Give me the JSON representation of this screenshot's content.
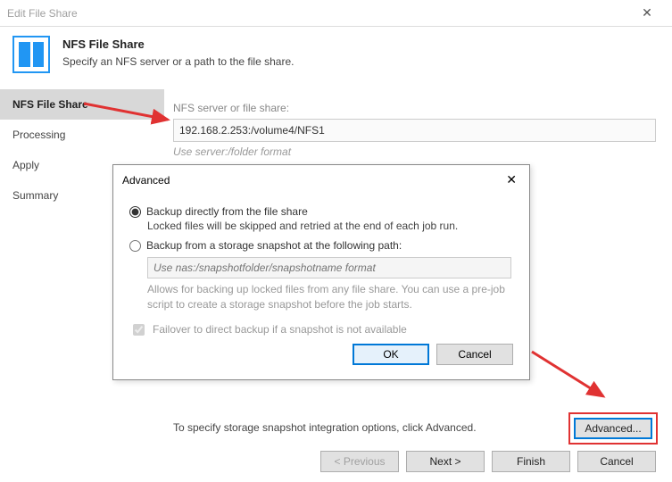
{
  "window": {
    "title": "Edit File Share"
  },
  "header": {
    "title": "NFS File Share",
    "subtitle": "Specify an NFS server or a path to the file share."
  },
  "sidebar": {
    "items": [
      {
        "label": "NFS File Share"
      },
      {
        "label": "Processing"
      },
      {
        "label": "Apply"
      },
      {
        "label": "Summary"
      }
    ]
  },
  "main": {
    "field_label": "NFS server or file share:",
    "path_value": "192.168.2.253:/volume4/NFS1",
    "format_hint": "Use server:/folder format",
    "snapshot_text": "To specify storage snapshot integration options, click Advanced.",
    "advanced_button": "Advanced..."
  },
  "footer": {
    "previous": "< Previous",
    "next": "Next >",
    "finish": "Finish",
    "cancel": "Cancel"
  },
  "modal": {
    "title": "Advanced",
    "option1_label": "Backup directly from the file share",
    "option1_desc": "Locked files will be skipped and retried at the end of each job run.",
    "option2_label": "Backup from a storage snapshot at the following path:",
    "snapshot_placeholder": "Use nas:/snapshotfolder/snapshotname format",
    "snapshot_hint": "Allows for backing up locked files from any file share. You can use a pre-job script to create a storage snapshot before the job starts.",
    "failover_label": "Failover to direct backup if a snapshot is not available",
    "ok": "OK",
    "cancel": "Cancel"
  }
}
